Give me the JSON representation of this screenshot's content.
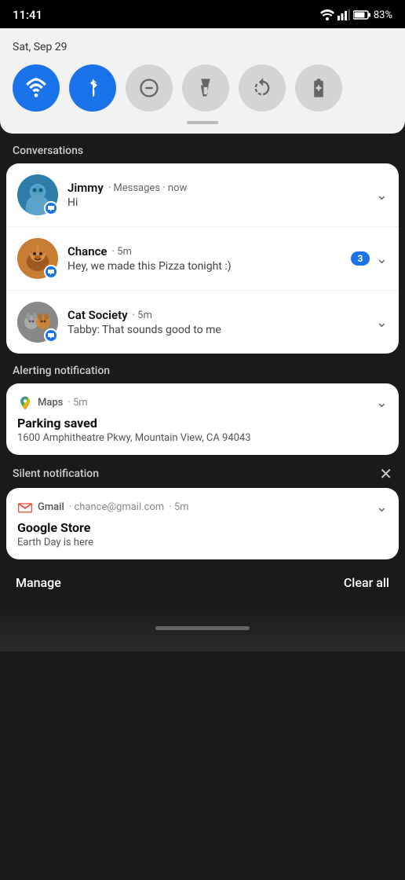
{
  "statusBar": {
    "time": "11:41",
    "battery": "83%"
  },
  "quickSettings": {
    "date": "Sat, Sep 29",
    "tiles": [
      {
        "id": "wifi",
        "active": true,
        "label": "Wi-Fi"
      },
      {
        "id": "bluetooth",
        "active": true,
        "label": "Bluetooth"
      },
      {
        "id": "dnd",
        "active": false,
        "label": "Do Not Disturb"
      },
      {
        "id": "flashlight",
        "active": false,
        "label": "Flashlight"
      },
      {
        "id": "autorotate",
        "active": false,
        "label": "Auto-rotate"
      },
      {
        "id": "battery",
        "active": false,
        "label": "Battery Saver"
      }
    ]
  },
  "conversations": {
    "sectionLabel": "Conversations",
    "items": [
      {
        "id": "jimmy",
        "name": "Jimmy",
        "app": "Messages",
        "time": "now",
        "preview": "Hi",
        "badge": null
      },
      {
        "id": "chance",
        "name": "Chance",
        "app": null,
        "time": "5m",
        "preview": "Hey, we made this Pizza tonight :)",
        "badge": "3"
      },
      {
        "id": "cat-society",
        "name": "Cat Society",
        "app": null,
        "time": "5m",
        "preview": "Tabby: That sounds good to me",
        "badge": null
      }
    ]
  },
  "alertingNotification": {
    "sectionLabel": "Alerting notification",
    "app": "Maps",
    "time": "5m",
    "title": "Parking saved",
    "body": "1600 Amphitheatre Pkwy, Mountain View, CA 94043"
  },
  "silentNotification": {
    "sectionLabel": "Silent notification",
    "app": "Gmail",
    "sender": "chance@gmail.com",
    "time": "5m",
    "title": "Google Store",
    "body": "Earth Day is here"
  },
  "bottomBar": {
    "manageLabel": "Manage",
    "clearAllLabel": "Clear all"
  }
}
